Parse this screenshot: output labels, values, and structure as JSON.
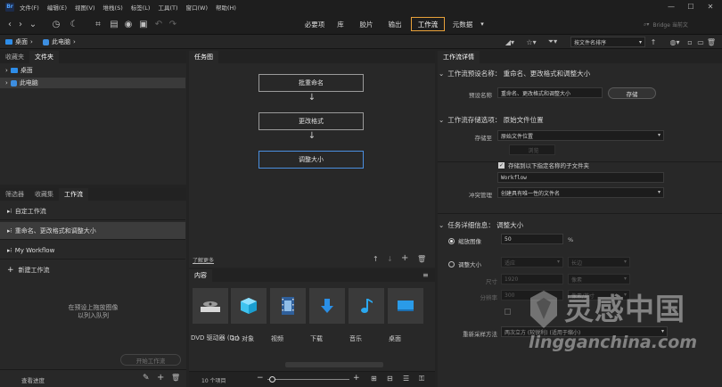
{
  "app": {
    "logo_text": "Br"
  },
  "menu": {
    "items": [
      "文件(F)",
      "编辑(E)",
      "视图(V)",
      "堆栈(S)",
      "标签(L)",
      "工具(T)",
      "窗口(W)",
      "帮助(H)"
    ]
  },
  "toolbar": {
    "workspaces": [
      "必要项",
      "库",
      "胶片",
      "输出",
      "工作流",
      "元数据"
    ],
    "active_workspace": "工作流",
    "search_placeholder": "Bridge 当前文"
  },
  "path": {
    "items": [
      "桌面",
      "此电脑"
    ],
    "sort_label": "按文件名排序"
  },
  "left_top": {
    "tabs": [
      "收藏夹",
      "文件夹"
    ],
    "active_tab": "文件夹",
    "tree": [
      "桌面",
      "此电脑"
    ]
  },
  "left_bottom": {
    "tabs": [
      "筛选器",
      "收藏集",
      "工作流"
    ],
    "active_tab": "工作流",
    "workflows": [
      "自定工作流",
      "重命名、更改格式和调整大小",
      "My Workflow"
    ],
    "new_workflow": "新建工作流",
    "drop_hint_line1": "在预设上拖放图像",
    "drop_hint_line2": "以列入队列",
    "start_button": "开始工作流",
    "queue_link": "查看进度"
  },
  "graph": {
    "tab": "任务图",
    "steps": [
      "批重命名",
      "更改格式",
      "调整大小"
    ],
    "footer_link": "了解更多"
  },
  "content": {
    "tab": "内容",
    "items": [
      "DVD 驱动器 (D:)",
      "3D 对象",
      "视频",
      "下载",
      "音乐",
      "桌面"
    ],
    "count": "10 个项目"
  },
  "details": {
    "tab": "工作流详情",
    "preset_section": "工作流预设名称： 重命名、更改格式和调整大小",
    "preset_label": "预设名称",
    "preset_value": "重命名、更改格式和调整大小",
    "save_button": "存储",
    "storage_section": "工作流存储选项： 原始文件位置",
    "save_to_label": "存储至",
    "save_to_value": "原始文件位置",
    "browse_button": "浏览",
    "subfolder_checkbox": "存储到以下指定名称的子文件夹",
    "subfolder_value": "Workflow",
    "conflict_label": "冲突管理",
    "conflict_value": "创建具有唯一性的文件名",
    "task_section": "任务详细信息： 调整大小",
    "scale_label": "缩放图像",
    "scale_value": "50",
    "scale_unit": "%",
    "resize_label": "调整大小",
    "resize_opt1": "适应",
    "resize_opt2": "长边",
    "size_label": "尺寸",
    "size_value": "1920",
    "size_unit": "像素",
    "res_label": "分辨率",
    "res_value": "300",
    "res_unit": "像素/英寸",
    "resample_label": "重新采样方法",
    "resample_value": "两次立方 (较锐利) (适用于缩小)"
  },
  "watermark": {
    "cn": "灵感中国",
    "url": "lingganchina.com"
  }
}
